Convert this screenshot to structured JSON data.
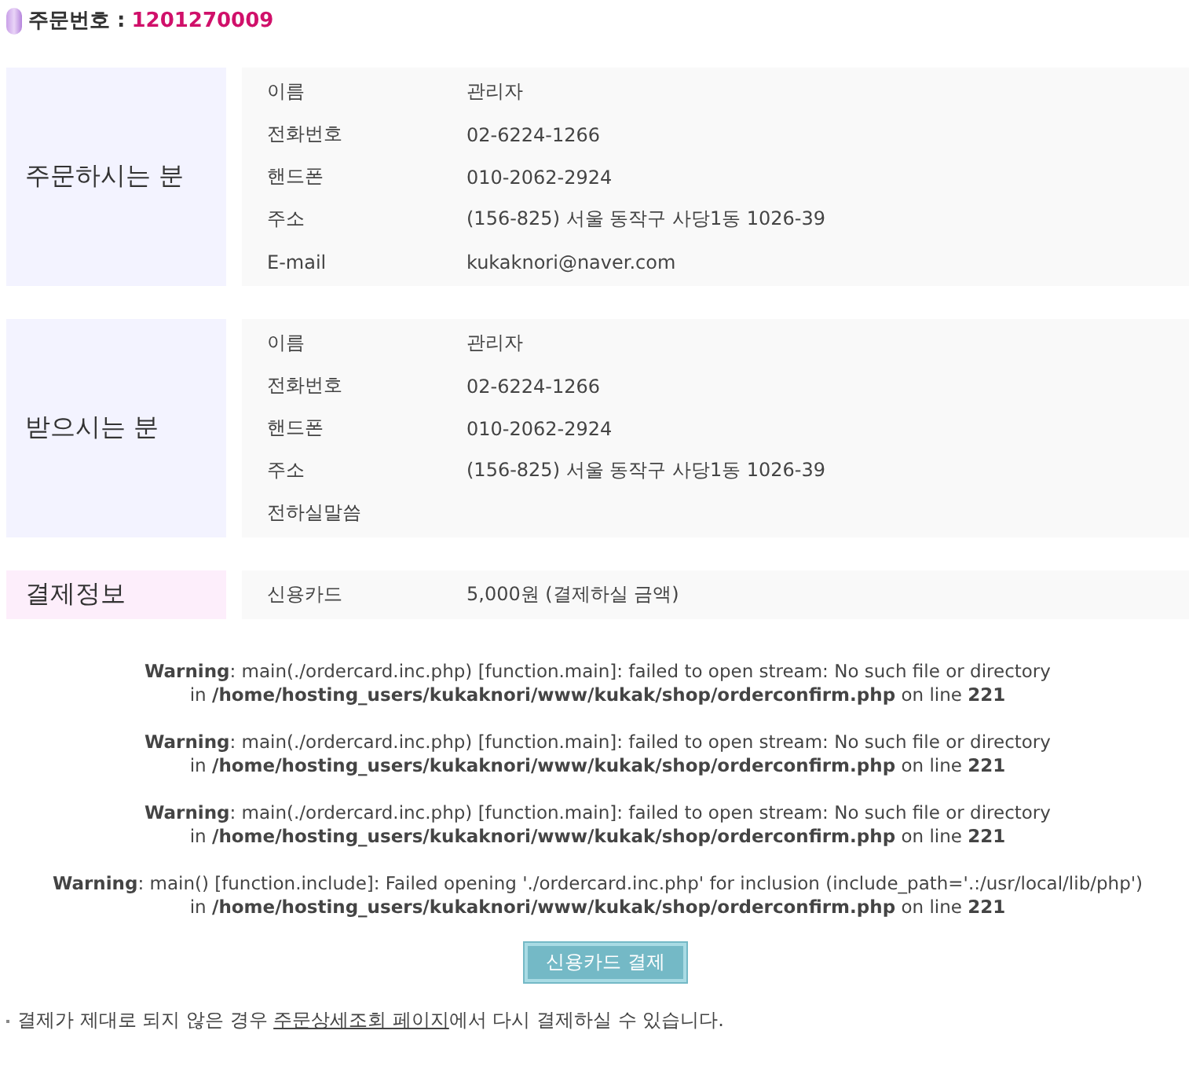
{
  "order": {
    "label": "주문번호 :",
    "number": "1201270009"
  },
  "sections": [
    {
      "title": "주문하시는 분",
      "color": "#f3f3ff",
      "rows": [
        {
          "label": "이름",
          "value": "관리자"
        },
        {
          "label": "전화번호",
          "value": "02-6224-1266"
        },
        {
          "label": "핸드폰",
          "value": "010-2062-2924"
        },
        {
          "label": "주소",
          "value": "(156-825) 서울 동작구 사당1동 1026-39"
        },
        {
          "label": "E-mail",
          "value": "kukaknori@naver.com"
        }
      ]
    },
    {
      "title": "받으시는 분",
      "color": "#f3f3ff",
      "rows": [
        {
          "label": "이름",
          "value": "관리자"
        },
        {
          "label": "전화번호",
          "value": "02-6224-1266"
        },
        {
          "label": "핸드폰",
          "value": "010-2062-2924"
        },
        {
          "label": "주소",
          "value": "(156-825) 서울 동작구 사당1동 1026-39"
        },
        {
          "label": "전하실말씀"
        }
      ]
    },
    {
      "title": "결제정보",
      "color": "#fdeefb",
      "rows": [
        {
          "label": "신용카드",
          "value": "5,000원 (결제하실 금액)"
        }
      ]
    }
  ],
  "warnings": [
    {
      "line1": "**Warning**: main(./ordercard.inc.php) [function.main]: failed to open stream: No such file or directory",
      "line2": "in **/home/hosting_users/kukaknori/www/kukak/shop/orderconfirm.php** on line **221**"
    },
    {
      "line1": "**Warning**: main(./ordercard.inc.php) [function.main]: failed to open stream: No such file or directory",
      "line2": "in **/home/hosting_users/kukaknori/www/kukak/shop/orderconfirm.php** on line **221**"
    },
    {
      "line1": "**Warning**: main(./ordercard.inc.php) [function.main]: failed to open stream: No such file or directory",
      "line2": "in **/home/hosting_users/kukaknori/www/kukak/shop/orderconfirm.php** on line **221**"
    },
    {
      "line1": "**Warning**: main() [function.include]: Failed opening './ordercard.inc.php' for inclusion (include_path='.:/usr/local/lib/php')",
      "line2": "in **/home/hosting_users/kukaknori/www/kukak/shop/orderconfirm.php** on line **221**"
    }
  ],
  "pay_button": "신용카드 결제",
  "note": {
    "before": "결제가 제대로 되지 않은 경우 ",
    "link": "주문상세조회 페이지",
    "after": "에서 다시 결제하실 수 있습니다."
  }
}
